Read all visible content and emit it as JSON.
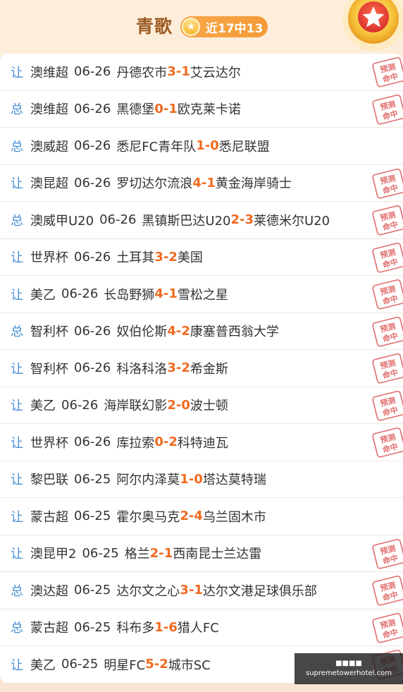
{
  "header": {
    "name": "青歌",
    "badge_text": "近17中13"
  },
  "rows": [
    {
      "tag": "让",
      "league": "澳维超",
      "date": "06-26",
      "home": "丹德农市",
      "score_home": "3",
      "score_away": "1",
      "away": "艾云达尔",
      "hit": true
    },
    {
      "tag": "总",
      "league": "澳维超",
      "date": "06-26",
      "home": "黑德堡",
      "score_home": "0",
      "score_away": "1",
      "away": "欧克莱卡诺",
      "hit": true
    },
    {
      "tag": "总",
      "league": "澳威超",
      "date": "06-26",
      "home": "悉尼FC青年队",
      "score_home": "1",
      "score_away": "0",
      "away": "悉尼联盟",
      "hit": false
    },
    {
      "tag": "让",
      "league": "澳昆超",
      "date": "06-26",
      "home": "罗切达尔流浪",
      "score_home": "4",
      "score_away": "1",
      "away": "黄金海岸骑士",
      "hit": true
    },
    {
      "tag": "总",
      "league": "澳威甲U20",
      "date": "06-26",
      "home": "黑镇斯巴达U20",
      "score_home": "2",
      "score_away": "3",
      "away": "莱德米尔U20",
      "hit": true
    },
    {
      "tag": "让",
      "league": "世界杯",
      "date": "06-26",
      "home": "土耳其",
      "score_home": "3",
      "score_away": "2",
      "away": "美国",
      "hit": true
    },
    {
      "tag": "让",
      "league": "美乙",
      "date": "06-26",
      "home": "长岛野狮",
      "score_home": "4",
      "score_away": "1",
      "away": "雪松之星",
      "hit": true
    },
    {
      "tag": "总",
      "league": "智利杯",
      "date": "06-26",
      "home": "奴伯伦斯",
      "score_home": "4",
      "score_away": "2",
      "away": "康塞普西翁大学",
      "hit": true
    },
    {
      "tag": "让",
      "league": "智利杯",
      "date": "06-26",
      "home": "科洛科洛",
      "score_home": "3",
      "score_away": "2",
      "away": "希金斯",
      "hit": true
    },
    {
      "tag": "让",
      "league": "美乙",
      "date": "06-26",
      "home": "海岸联幻影",
      "score_home": "2",
      "score_away": "0",
      "away": "波士顿",
      "hit": true
    },
    {
      "tag": "让",
      "league": "世界杯",
      "date": "06-26",
      "home": "库拉索",
      "score_home": "0",
      "score_away": "2",
      "away": "科特迪瓦",
      "hit": true
    },
    {
      "tag": "让",
      "league": "黎巴联",
      "date": "06-25",
      "home": "阿尔内泽莫",
      "score_home": "1",
      "score_away": "0",
      "away": "塔达莫特瑞",
      "hit": false
    },
    {
      "tag": "让",
      "league": "蒙古超",
      "date": "06-25",
      "home": "霍尔奥马克",
      "score_home": "2",
      "score_away": "4",
      "away": "乌兰固木市",
      "hit": false
    },
    {
      "tag": "让",
      "league": "澳昆甲2",
      "date": "06-25",
      "home": "格兰",
      "score_home": "2",
      "score_away": "1",
      "away": "西南昆士兰达雷",
      "hit": true
    },
    {
      "tag": "总",
      "league": "澳达超",
      "date": "06-25",
      "home": "达尔文之心",
      "score_home": "3",
      "score_away": "1",
      "away": "达尔文港足球俱乐部",
      "hit": true
    },
    {
      "tag": "总",
      "league": "蒙古超",
      "date": "06-25",
      "home": "科布多",
      "score_home": "1",
      "score_away": "6",
      "away": "猎人FC",
      "hit": true
    },
    {
      "tag": "让",
      "league": "美乙",
      "date": "06-25",
      "home": "明星FC",
      "score_home": "5",
      "score_away": "2",
      "away": "城市SC",
      "hit": true
    }
  ],
  "stamp_text": [
    "预测",
    "命中"
  ],
  "watermark": {
    "line1": "■■■■",
    "line2": "suprem​etowerhotel.com"
  },
  "colors": {
    "tag": "#4a8fd6",
    "score": "#f06a1f",
    "stamp": "#d94a4a",
    "name": "#9b5a22"
  }
}
